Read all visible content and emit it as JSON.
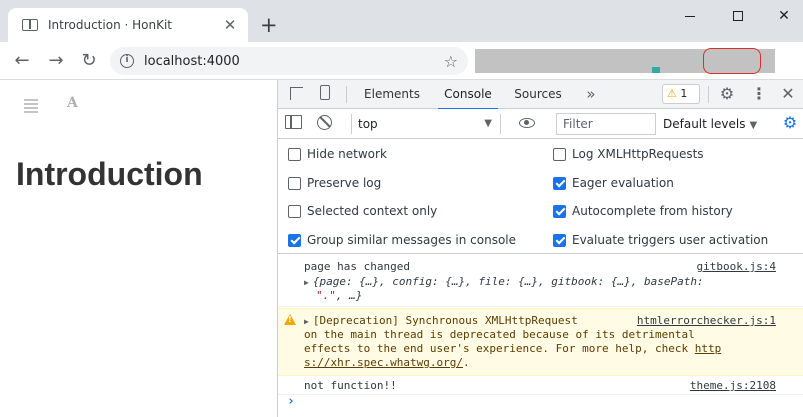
{
  "browser": {
    "tab_title": "Introduction · HonKit",
    "tab_close": "✕",
    "new_tab": "+",
    "url": "localhost:4000",
    "icons": [
      "tab-favicon-icon",
      "back-arrow-icon",
      "forward-arrow-icon",
      "reload-icon",
      "info-icon",
      "star-icon"
    ]
  },
  "page": {
    "heading": "Introduction",
    "font_icon": "A"
  },
  "devtools": {
    "tabs": [
      "Elements",
      "Console",
      "Sources"
    ],
    "active_tab": "Console",
    "more_tabs": "»",
    "warning_count": "1",
    "context": "top",
    "filter_placeholder": "Filter",
    "levels": "Default levels",
    "settings": {
      "left": [
        {
          "label": "Hide network",
          "checked": false
        },
        {
          "label": "Preserve log",
          "checked": false
        },
        {
          "label": "Selected context only",
          "checked": false
        },
        {
          "label": "Group similar messages in console",
          "checked": true
        }
      ],
      "right": [
        {
          "label": "Log XMLHttpRequests",
          "checked": false
        },
        {
          "label": "Eager evaluation",
          "checked": true
        },
        {
          "label": "Autocomplete from history",
          "checked": true
        },
        {
          "label": "Evaluate triggers user activation",
          "checked": true
        }
      ]
    },
    "console": {
      "msg1": {
        "text": "page has changed",
        "source": "gitbook.js:4",
        "obj_line1": "{page: {…}, config: {…}, file: {…}, gitbook: {…}, basePath:",
        "obj_str": "\".\"",
        "obj_line2_rest": ", …}"
      },
      "warn": {
        "line1": "[Deprecation] Synchronous XMLHttpRequest",
        "source": "htmlerrorchecker.js:1",
        "line2": "on the main thread is deprecated because of its detrimental",
        "line3_text": "effects to the end user's experience. For more help, check ",
        "line3_link": "http",
        "line4_link": "s://xhr.spec.whatwg.org/",
        "line4_rest": "."
      },
      "msg2": {
        "text": "not function!!",
        "source": "theme.js:2108"
      },
      "prompt": "›"
    }
  },
  "colors": {
    "accent": "#1a73e8",
    "warning_bg": "#fffbe5",
    "warning_icon": "#f2a600",
    "string": "#c41a16"
  }
}
